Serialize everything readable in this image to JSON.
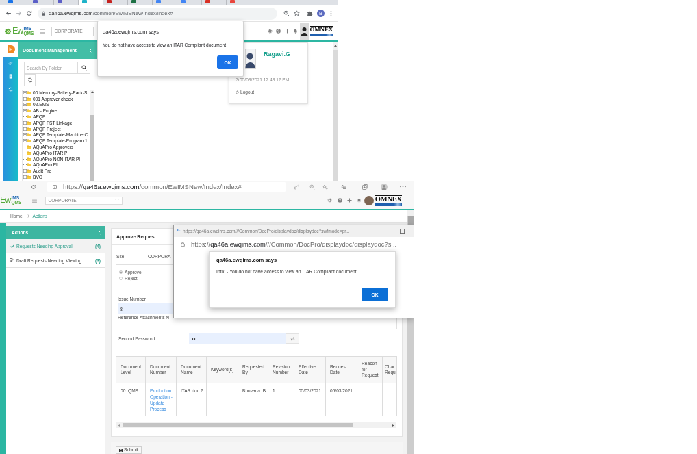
{
  "top_screen": {
    "browser": {
      "tabs": [
        {
          "selected": false,
          "color": "#1a73e8"
        },
        {
          "selected": false,
          "color": "#5b5fc7"
        },
        {
          "selected": false,
          "color": "#5b5fc7"
        },
        {
          "selected": true,
          "color": "#1fb3c9"
        },
        {
          "selected": false,
          "color": "#c5221f"
        },
        {
          "selected": false,
          "color": "#1e7145"
        },
        {
          "selected": false,
          "color": "#4285f4"
        },
        {
          "selected": false,
          "color": "#4285f4"
        },
        {
          "selected": false,
          "color": "#d93025"
        },
        {
          "selected": false,
          "color": "#e8453c"
        }
      ],
      "url_domain": "qa46a.ewqims.com",
      "url_path": "/common/EwIMSNew/Index/Index#",
      "profile_initial": "B"
    },
    "header": {
      "logo_main": "Ew",
      "logo_top": "IMS",
      "logo_bottom": "QMS",
      "site": "CORPORATE",
      "brand": "OMNEX"
    },
    "sidebar": {
      "title": "Document Management",
      "search": {
        "placeholder": "Search By Folder"
      },
      "tree": [
        {
          "label": "00 Mercury-Battery-Pack-S",
          "expandable": true
        },
        {
          "label": "001 Approver check",
          "expandable": true
        },
        {
          "label": "02.EMS",
          "expandable": true
        },
        {
          "label": "AB - Engine",
          "expandable": true
        },
        {
          "label": "APQP",
          "expandable": false
        },
        {
          "label": "APQP FST Linkage",
          "expandable": true
        },
        {
          "label": "APQP Project",
          "expandable": true
        },
        {
          "label": "APQP Template-Machine C",
          "expandable": true
        },
        {
          "label": "APQP Template-Program 1",
          "expandable": true
        },
        {
          "label": "AQuAPro Approvers",
          "expandable": false
        },
        {
          "label": "AQuAPro ITAR PI",
          "expandable": false
        },
        {
          "label": "AQuAPro NON-ITAR PI",
          "expandable": false
        },
        {
          "label": "AQuAPro PI",
          "expandable": false
        },
        {
          "label": "Audit Pro",
          "expandable": true
        },
        {
          "label": "BVC",
          "expandable": true
        }
      ]
    },
    "alert": {
      "title": "qa46a.ewqims.com says",
      "message": "You do not have access to view an ITAR Compliant document",
      "button": "OK"
    },
    "profile_menu": {
      "name": "Ragavi.G",
      "login_time": "05/03/2021 12:43:12 PM",
      "logout": "Logout"
    }
  },
  "bottom_screen": {
    "browser": {
      "url_scheme": "https://",
      "url_domain": "qa46a.ewqims.com",
      "url_path": "/common/EwIMSNew/Index/Index#"
    },
    "header": {
      "logo_main": "Ew",
      "logo_top": "IMS",
      "logo_bottom": "QMS",
      "site": "CORPORATE",
      "brand": "OMNEX"
    },
    "breadcrumb": [
      {
        "label": "Home",
        "selected": false
      },
      {
        "label": "Actions",
        "selected": true
      }
    ],
    "sidebar": {
      "title": "Actions",
      "items": [
        {
          "label": "Requests Needing Approval",
          "count": "(4)",
          "selected": true,
          "kind": "approval"
        },
        {
          "label": "Draft Requests Needing Viewing",
          "count": "(3)",
          "selected": false,
          "kind": "draft"
        }
      ]
    },
    "form": {
      "title": "Approve Request",
      "site_label": "Site",
      "site_value": "CORPORA",
      "decision": [
        {
          "label": "Approve",
          "selected": true
        },
        {
          "label": "Reject",
          "selected": false
        }
      ],
      "issue_label": "Issue Number",
      "issue_value": "8",
      "attachments_label": "Reference Attachments N",
      "password_label": "Second Password",
      "password_value": "••"
    },
    "table": {
      "columns": [
        "Document Level",
        "Document Number",
        "Document Name",
        "Keyword(s)",
        "Requested By",
        "Revision Number",
        "Effective Date",
        "Request Date",
        "Reason for Request",
        "Char Requ"
      ],
      "rows": [
        {
          "cells": [
            {
              "text": "00. QMS",
              "kind": "text"
            },
            {
              "text": "Production Operation - Update Process",
              "kind": "link"
            },
            {
              "text": "ITAR doc 2",
              "kind": "text"
            },
            null,
            {
              "text": "Bhuvana .B",
              "kind": "text"
            },
            {
              "text": "1",
              "kind": "text"
            },
            {
              "text": "05/03/2021",
              "kind": "text"
            },
            {
              "text": "05/03/2021",
              "kind": "text"
            },
            null,
            null
          ]
        }
      ]
    },
    "submit": "Submit",
    "popup": {
      "title": "https://qa46a.ewqims.com///Common/DocPro/displaydoc/displaydoc?swfmode=pr...",
      "url_scheme": "https://",
      "url_domain": "qa46a.ewqims.com",
      "url_path": "///Common/DocPro/displaydoc/displaydoc?s...",
      "alert": {
        "title": "qa46a.ewqims.com says",
        "message": "Info: - You do not have access to view an ITAR Compliant document .",
        "button": "OK"
      }
    }
  }
}
